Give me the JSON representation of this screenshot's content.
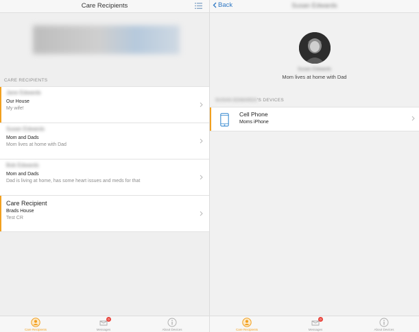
{
  "left": {
    "nav": {
      "title": "Care Recipients"
    },
    "section_header": "CARE RECIPIENTS",
    "recipients": [
      {
        "name": "Jane Edwards",
        "place": "Our House",
        "description": "My wife!"
      },
      {
        "name": "Susan Edwards",
        "place": "Mom and Dads",
        "description": "Mom lives at home with Dad"
      },
      {
        "name": "Bob Edwards",
        "place": "Mom and Dads",
        "description": "Dad is living at home, has some heart issues and meds for that"
      },
      {
        "name": "Care Recipient",
        "place": "Brads House",
        "description": "Test CR"
      }
    ]
  },
  "right": {
    "nav": {
      "back_label": "Back",
      "title": "Susan Edwards"
    },
    "profile": {
      "name": "Susan Edwards",
      "description": "Mom lives at home with Dad"
    },
    "devices_header_name": "SUSAN EDWARDS",
    "devices_header_suffix": "'S DEVICES",
    "device": {
      "name": "Cell Phone",
      "sub": "Moms iPhone"
    }
  },
  "tabs": [
    {
      "label": "Care Recipients",
      "active": true
    },
    {
      "label": "Messages",
      "badge": "0"
    },
    {
      "label": "About Devices"
    }
  ],
  "colors": {
    "accent": "#f2a01f",
    "link": "#2f78c4",
    "badge": "#e8423a"
  }
}
